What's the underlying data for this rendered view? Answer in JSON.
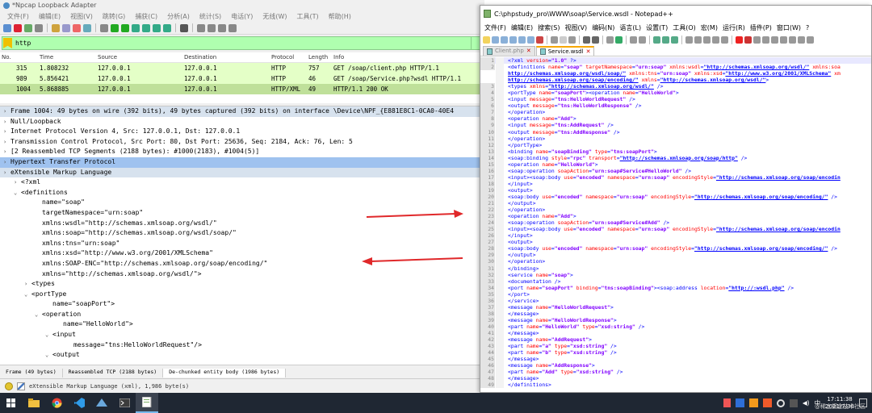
{
  "wireshark": {
    "title": "*Npcap Loopback Adapter",
    "menu": [
      "文件(F)",
      "编辑(E)",
      "视图(V)",
      "跳转(G)",
      "捕获(C)",
      "分析(A)",
      "统计(S)",
      "电话(Y)",
      "无线(W)",
      "工具(T)",
      "帮助(H)"
    ],
    "filter_value": "http",
    "columns": [
      "No.",
      "Time",
      "Source",
      "Destination",
      "Protocol",
      "Length",
      "Info"
    ],
    "packets": [
      {
        "no": "315",
        "time": "1.808232",
        "src": "127.0.0.1",
        "dst": "127.0.0.1",
        "proto": "HTTP",
        "len": "757",
        "info": "GET /soap/client.php HTTP/1.1"
      },
      {
        "no": "989",
        "time": "5.856421",
        "src": "127.0.0.1",
        "dst": "127.0.0.1",
        "proto": "HTTP",
        "len": "46",
        "info": "GET /soap/Service.php?wsdl HTTP/1.1"
      },
      {
        "no": "1004",
        "time": "5.868885",
        "src": "127.0.0.1",
        "dst": "127.0.0.1",
        "proto": "HTTP/XML",
        "len": "49",
        "info": "HTTP/1.1 200 OK"
      }
    ],
    "details": [
      {
        "t": "",
        "text": "Frame 1004: 49 bytes on wire (392 bits), 49 bytes captured (392 bits) on interface \\Device\\NPF_{E881E8C1-0CA0-40E4",
        "indent": 0,
        "cls": "hi"
      },
      {
        "t": "",
        "text": "Null/Loopback",
        "indent": 0,
        "cls": ""
      },
      {
        "t": "",
        "text": "Internet Protocol Version 4, Src: 127.0.0.1, Dst: 127.0.0.1",
        "indent": 0,
        "cls": ""
      },
      {
        "t": "",
        "text": "Transmission Control Protocol, Src Port: 80, Dst Port: 25636, Seq: 2184, Ack: 76, Len: 5",
        "indent": 0,
        "cls": ""
      },
      {
        "t": "",
        "text": "[2 Reassembled TCP Segments (2188 bytes): #1000(2183), #1004(5)]",
        "indent": 0,
        "cls": ""
      },
      {
        "t": "",
        "text": "Hypertext Transfer Protocol",
        "indent": 0,
        "cls": "http"
      },
      {
        "t": "",
        "text": "eXtensible Markup Language",
        "indent": 0,
        "cls": "hi"
      },
      {
        "t": ">",
        "text": "<?xml",
        "indent": 1,
        "cls": ""
      },
      {
        "t": "v",
        "text": "<definitions",
        "indent": 1,
        "cls": ""
      },
      {
        "t": "",
        "text": "name=\"soap\"",
        "indent": 3,
        "cls": ""
      },
      {
        "t": "",
        "text": "targetNamespace=\"urn:soap\"",
        "indent": 3,
        "cls": ""
      },
      {
        "t": "",
        "text": "xmlns:wsdl=\"http://schemas.xmlsoap.org/wsdl/\"",
        "indent": 3,
        "cls": ""
      },
      {
        "t": "",
        "text": "xmlns:soap=\"http://schemas.xmlsoap.org/wsdl/soap/\"",
        "indent": 3,
        "cls": ""
      },
      {
        "t": "",
        "text": "xmlns:tns=\"urn:soap\"",
        "indent": 3,
        "cls": ""
      },
      {
        "t": "",
        "text": "xmlns:xsd=\"http://www.w3.org/2001/XMLSchema\"",
        "indent": 3,
        "cls": ""
      },
      {
        "t": "",
        "text": "xmlns:SOAP-ENC=\"http://schemas.xmlsoap.org/soap/encoding/\"",
        "indent": 3,
        "cls": ""
      },
      {
        "t": "",
        "text": "xmlns=\"http://schemas.xmlsoap.org/wsdl/\">",
        "indent": 3,
        "cls": ""
      },
      {
        "t": ">",
        "text": "<types",
        "indent": 2,
        "cls": ""
      },
      {
        "t": "v",
        "text": "<portType",
        "indent": 2,
        "cls": ""
      },
      {
        "t": "",
        "text": "name=\"soapPort\">",
        "indent": 4,
        "cls": ""
      },
      {
        "t": "v",
        "text": "<operation",
        "indent": 3,
        "cls": ""
      },
      {
        "t": "",
        "text": "name=\"HelloWorld\">",
        "indent": 5,
        "cls": ""
      },
      {
        "t": "v",
        "text": "<input",
        "indent": 4,
        "cls": ""
      },
      {
        "t": "",
        "text": "message=\"tns:HelloWorldRequest\"/>",
        "indent": 6,
        "cls": ""
      },
      {
        "t": "v",
        "text": "<output",
        "indent": 4,
        "cls": ""
      }
    ],
    "byte_tabs": [
      "Frame (49 bytes)",
      "Reassembled TCP (2188 bytes)",
      "De-chunked entity body (1986 bytes)"
    ],
    "status_text": "eXtensible Markup Language (xml), 1,986 byte(s)"
  },
  "notepad": {
    "title": "C:\\phpstudy_pro\\WWW\\soap\\Service.wsdl - Notepad++",
    "menu": [
      "文件(F)",
      "编辑(E)",
      "搜索(S)",
      "视图(V)",
      "编码(N)",
      "语言(L)",
      "设置(T)",
      "工具(O)",
      "宏(M)",
      "运行(R)",
      "插件(P)",
      "窗口(W)",
      "?"
    ],
    "tabs": [
      {
        "label": "Client.php",
        "active": false
      },
      {
        "label": "Service.wsdl",
        "active": true
      }
    ],
    "lines": [
      {
        "n": "1",
        "html": "<span class='t'>&lt;?xml</span> <span class='a'>version</span>=<span class='v'>\"1.0\"</span> <span class='t'>?&gt;</span>"
      },
      {
        "n": "2",
        "html": "<span class='t'>&lt;definitions</span> <span class='a'>name</span>=<span class='v'>\"soap\"</span> <span class='a'>targetNamespace</span>=<span class='v'>\"urn:soap\"</span> <span class='a'>xmlns:wsdl</span>=<span class='u'>\"http://schemas.xmlsoap.org/wsdl/\"</span> <span class='a'>xmlns:soa</span>"
      },
      {
        "n": "",
        "html": "<span class='u'>http://schemas.xmlsoap.org/wsdl/soap/\"</span> <span class='a'>xmlns:tns</span>=<span class='v'>\"urn:soap\"</span> <span class='a'>xmlns:xsd</span>=<span class='u'>\"http://www.w3.org/2001/XMLSchema\"</span> <span class='a'>xm</span>"
      },
      {
        "n": "",
        "html": "<span class='u'>http://schemas.xmlsoap.org/soap/encoding/\"</span> <span class='a'>xmlns</span>=<span class='u'>\"http://schemas.xmlsoap.org/wsdl/\"</span><span class='t'>&gt;</span>"
      },
      {
        "n": "3",
        "html": "<span class='t'>&lt;types</span> <span class='a'>xmlns</span>=<span class='u'>\"http://schemas.xmlsoap.org/wsdl/\"</span> <span class='t'>/&gt;</span>"
      },
      {
        "n": "4",
        "html": "<span class='t'>&lt;portType</span> <span class='a'>name</span>=<span class='v'>\"soapPort\"</span><span class='t'>&gt;&lt;operation</span> <span class='a'>name</span>=<span class='v'>\"HelloWorld\"</span><span class='t'>&gt;</span>"
      },
      {
        "n": "5",
        "html": "<span class='t'>&lt;input</span> <span class='a'>message</span>=<span class='v'>\"tns:HelloWorldRequest\"</span> <span class='t'>/&gt;</span>"
      },
      {
        "n": "6",
        "html": "<span class='t'>&lt;output</span> <span class='a'>message</span>=<span class='v'>\"tns:HelloWorldResponse\"</span> <span class='t'>/&gt;</span>"
      },
      {
        "n": "7",
        "html": "<span class='t'>&lt;/operation&gt;</span>"
      },
      {
        "n": "8",
        "html": "<span class='t'>&lt;operation</span> <span class='a'>name</span>=<span class='v'>\"Add\"</span><span class='t'>&gt;</span>"
      },
      {
        "n": "9",
        "html": "<span class='t'>&lt;input</span> <span class='a'>message</span>=<span class='v'>\"tns:AddRequest\"</span> <span class='t'>/&gt;</span>"
      },
      {
        "n": "10",
        "html": "<span class='t'>&lt;output</span> <span class='a'>message</span>=<span class='v'>\"tns:AddResponse\"</span> <span class='t'>/&gt;</span>"
      },
      {
        "n": "11",
        "html": "<span class='t'>&lt;/operation&gt;</span>"
      },
      {
        "n": "12",
        "html": "<span class='t'>&lt;/portType&gt;</span>"
      },
      {
        "n": "13",
        "html": "<span class='t'>&lt;binding</span> <span class='a'>name</span>=<span class='v'>\"soapBinding\"</span> <span class='a'>type</span>=<span class='v'>\"tns:soapPort\"</span><span class='t'>&gt;</span>"
      },
      {
        "n": "14",
        "html": "<span class='t'>&lt;soap:binding</span> <span class='a'>style</span>=<span class='v'>\"rpc\"</span> <span class='a'>transport</span>=<span class='u'>\"http://schemas.xmlsoap.org/soap/http\"</span> <span class='t'>/&gt;</span>"
      },
      {
        "n": "15",
        "html": "<span class='t'>&lt;operation</span> <span class='a'>name</span>=<span class='v'>\"HelloWorld\"</span><span class='t'>&gt;</span>"
      },
      {
        "n": "16",
        "html": "<span class='t'>&lt;soap:operation</span> <span class='a'>soapAction</span>=<span class='v'>\"urn:soap#Service#HelloWorld\"</span> <span class='t'>/&gt;</span>"
      },
      {
        "n": "17",
        "html": "<span class='t'>&lt;input&gt;&lt;soap:body</span> <span class='a'>use</span>=<span class='v'>\"encoded\"</span> <span class='a'>namespace</span>=<span class='v'>\"urn:soap\"</span> <span class='a'>encodingStyle</span>=<span class='u'>\"http://schemas.xmlsoap.org/soap/encodin</span>"
      },
      {
        "n": "18",
        "html": "<span class='t'>&lt;/input&gt;</span>"
      },
      {
        "n": "19",
        "html": "<span class='t'>&lt;output&gt;</span>"
      },
      {
        "n": "20",
        "html": "<span class='t'>&lt;soap:body</span> <span class='a'>use</span>=<span class='v'>\"encoded\"</span> <span class='a'>namespace</span>=<span class='v'>\"urn:soap\"</span> <span class='a'>encodingStyle</span>=<span class='u'>\"http://schemas.xmlsoap.org/soap/encoding/\"</span> <span class='t'>/&gt;</span>"
      },
      {
        "n": "21",
        "html": "<span class='t'>&lt;/output&gt;</span>"
      },
      {
        "n": "22",
        "html": "<span class='t'>&lt;/operation&gt;</span>"
      },
      {
        "n": "23",
        "html": "<span class='t'>&lt;operation</span> <span class='a'>name</span>=<span class='v'>\"Add\"</span><span class='t'>&gt;</span>"
      },
      {
        "n": "24",
        "html": "<span class='t'>&lt;soap:operation</span> <span class='a'>soapAction</span>=<span class='v'>\"urn:soap#Service#Add\"</span> <span class='t'>/&gt;</span>"
      },
      {
        "n": "25",
        "html": "<span class='t'>&lt;input&gt;&lt;soap:body</span> <span class='a'>use</span>=<span class='v'>\"encoded\"</span> <span class='a'>namespace</span>=<span class='v'>\"urn:soap\"</span> <span class='a'>encodingStyle</span>=<span class='u'>\"http://schemas.xmlsoap.org/soap/encodin</span>"
      },
      {
        "n": "26",
        "html": "<span class='t'>&lt;/input&gt;</span>"
      },
      {
        "n": "27",
        "html": "<span class='t'>&lt;output&gt;</span>"
      },
      {
        "n": "28",
        "html": "<span class='t'>&lt;soap:body</span> <span class='a'>use</span>=<span class='v'>\"encoded\"</span> <span class='a'>namespace</span>=<span class='v'>\"urn:soap\"</span> <span class='a'>encodingStyle</span>=<span class='u'>\"http://schemas.xmlsoap.org/soap/encoding/\"</span> <span class='t'>/&gt;</span>"
      },
      {
        "n": "29",
        "html": "<span class='t'>&lt;/output&gt;</span>"
      },
      {
        "n": "30",
        "html": "<span class='t'>&lt;/operation&gt;</span>"
      },
      {
        "n": "31",
        "html": "<span class='t'>&lt;/binding&gt;</span>"
      },
      {
        "n": "32",
        "html": "<span class='t'>&lt;service</span> <span class='a'>name</span>=<span class='v'>\"soap\"</span><span class='t'>&gt;</span>"
      },
      {
        "n": "33",
        "html": "<span class='t'>&lt;documentation</span> <span class='t'>/&gt;</span>"
      },
      {
        "n": "34",
        "html": "<span class='t'>&lt;port</span> <span class='a'>name</span>=<span class='v'>\"soapPort\"</span> <span class='a'>binding</span>=<span class='v'>\"tns:soapBinding\"</span><span class='t'>&gt;&lt;soap:address</span> <span class='a'>location</span>=<span class='u'>\"http://:wsdl.php\"</span> <span class='t'>/&gt;</span>"
      },
      {
        "n": "35",
        "html": "<span class='t'>&lt;/port&gt;</span>"
      },
      {
        "n": "36",
        "html": "<span class='t'>&lt;/service&gt;</span>"
      },
      {
        "n": "37",
        "html": "<span class='t'>&lt;message</span> <span class='a'>name</span>=<span class='v'>\"HelloWorldRequest\"</span><span class='t'>&gt;</span>"
      },
      {
        "n": "38",
        "html": "<span class='t'>&lt;/message&gt;</span>"
      },
      {
        "n": "39",
        "html": "<span class='t'>&lt;message</span> <span class='a'>name</span>=<span class='v'>\"HelloWorldResponse\"</span><span class='t'>&gt;</span>"
      },
      {
        "n": "40",
        "html": "<span class='t'>&lt;part</span> <span class='a'>name</span>=<span class='v'>\"HelloWorld\"</span> <span class='a'>type</span>=<span class='v'>\"xsd:string\"</span> <span class='t'>/&gt;</span>"
      },
      {
        "n": "41",
        "html": "<span class='t'>&lt;/message&gt;</span>"
      },
      {
        "n": "42",
        "html": "<span class='t'>&lt;message</span> <span class='a'>name</span>=<span class='v'>\"AddRequest\"</span><span class='t'>&gt;</span>"
      },
      {
        "n": "43",
        "html": "<span class='t'>&lt;part</span> <span class='a'>name</span>=<span class='v'>\"a\"</span> <span class='a'>type</span>=<span class='v'>\"xsd:string\"</span> <span class='t'>/&gt;</span>"
      },
      {
        "n": "44",
        "html": "<span class='t'>&lt;part</span> <span class='a'>name</span>=<span class='v'>\"b\"</span> <span class='a'>type</span>=<span class='v'>\"xsd:string\"</span> <span class='t'>/&gt;</span>"
      },
      {
        "n": "45",
        "html": "<span class='t'>&lt;/message&gt;</span>"
      },
      {
        "n": "46",
        "html": "<span class='t'>&lt;message</span> <span class='a'>name</span>=<span class='v'>\"AddResponse\"</span><span class='t'>&gt;</span>"
      },
      {
        "n": "47",
        "html": "<span class='t'>&lt;part</span> <span class='a'>name</span>=<span class='v'>\"Add\"</span> <span class='a'>type</span>=<span class='v'>\"xsd:string\"</span> <span class='t'>/&gt;</span>"
      },
      {
        "n": "48",
        "html": "<span class='t'>&lt;/message&gt;</span>"
      },
      {
        "n": "49",
        "html": "<span class='t'>&lt;/definitions&gt;</span>"
      }
    ]
  },
  "taskbar": {
    "apps": [
      "windows-start",
      "file-explorer",
      "chrome",
      "vscode",
      "wireshark",
      "terminal",
      "notepad-plus-plus"
    ],
    "time": "17:11:38",
    "date": "2021/7/30",
    "ime": "中",
    "watermark": "@稀土掘金技术社区"
  },
  "colors": {
    "filter_bg": "#afffaf",
    "http_row": "#e4ffc7",
    "selected_packet": "#bfe09a",
    "http_detail": "#9fc2ef",
    "arrow": "#e0282a",
    "taskbar": "#1f2733"
  }
}
